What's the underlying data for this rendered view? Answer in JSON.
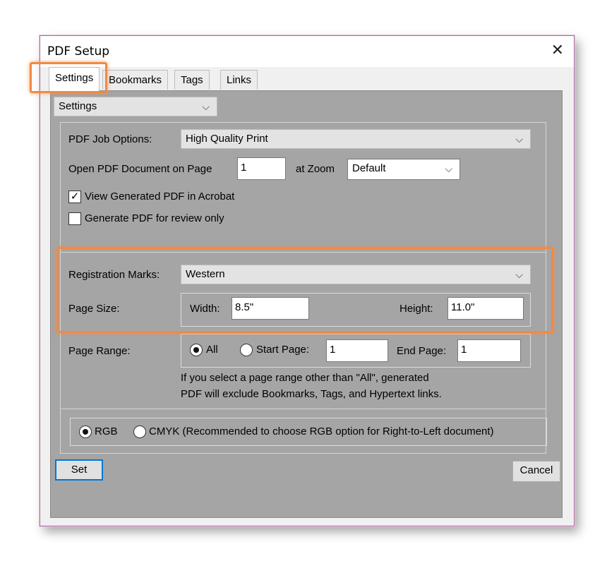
{
  "window": {
    "title": "PDF Setup"
  },
  "tabs": [
    "Settings",
    "Bookmarks",
    "Tags",
    "Links"
  ],
  "section_select": {
    "value": "Settings"
  },
  "job_options": {
    "label": "PDF Job Options:",
    "value": "High Quality Print"
  },
  "open_page": {
    "label": "Open PDF Document on Page",
    "value": "1",
    "zoom_label": "at Zoom",
    "zoom_value": "Default"
  },
  "view_generated": {
    "label": "View Generated PDF in Acrobat",
    "checked": true
  },
  "review_only": {
    "label": "Generate PDF for review only",
    "checked": false
  },
  "registration": {
    "label": "Registration Marks:",
    "value": "Western"
  },
  "page_size": {
    "label": "Page Size:",
    "width_label": "Width:",
    "width_value": "8.5\"",
    "height_label": "Height:",
    "height_value": "11.0\""
  },
  "page_range": {
    "label": "Page Range:",
    "all_label": "All",
    "start_label": "Start Page:",
    "start_value": "1",
    "end_label": "End Page:",
    "end_value": "1",
    "note_line1": "If you select a page range other than \"All\",  generated",
    "note_line2": "PDF will exclude Bookmarks, Tags, and Hypertext links."
  },
  "color": {
    "rgb_label": "RGB",
    "cmyk_label": "CMYK (Recommended to choose RGB option for Right-to-Left document)",
    "selected": "RGB"
  },
  "buttons": {
    "set": "Set",
    "cancel": "Cancel"
  },
  "icons": {
    "close": "close-icon",
    "chevron": "chevron-down-icon",
    "check": "checkmark-icon"
  },
  "colors": {
    "highlight": "#f08a45",
    "panel": "#a5a5a5",
    "focus": "#0078d7"
  }
}
